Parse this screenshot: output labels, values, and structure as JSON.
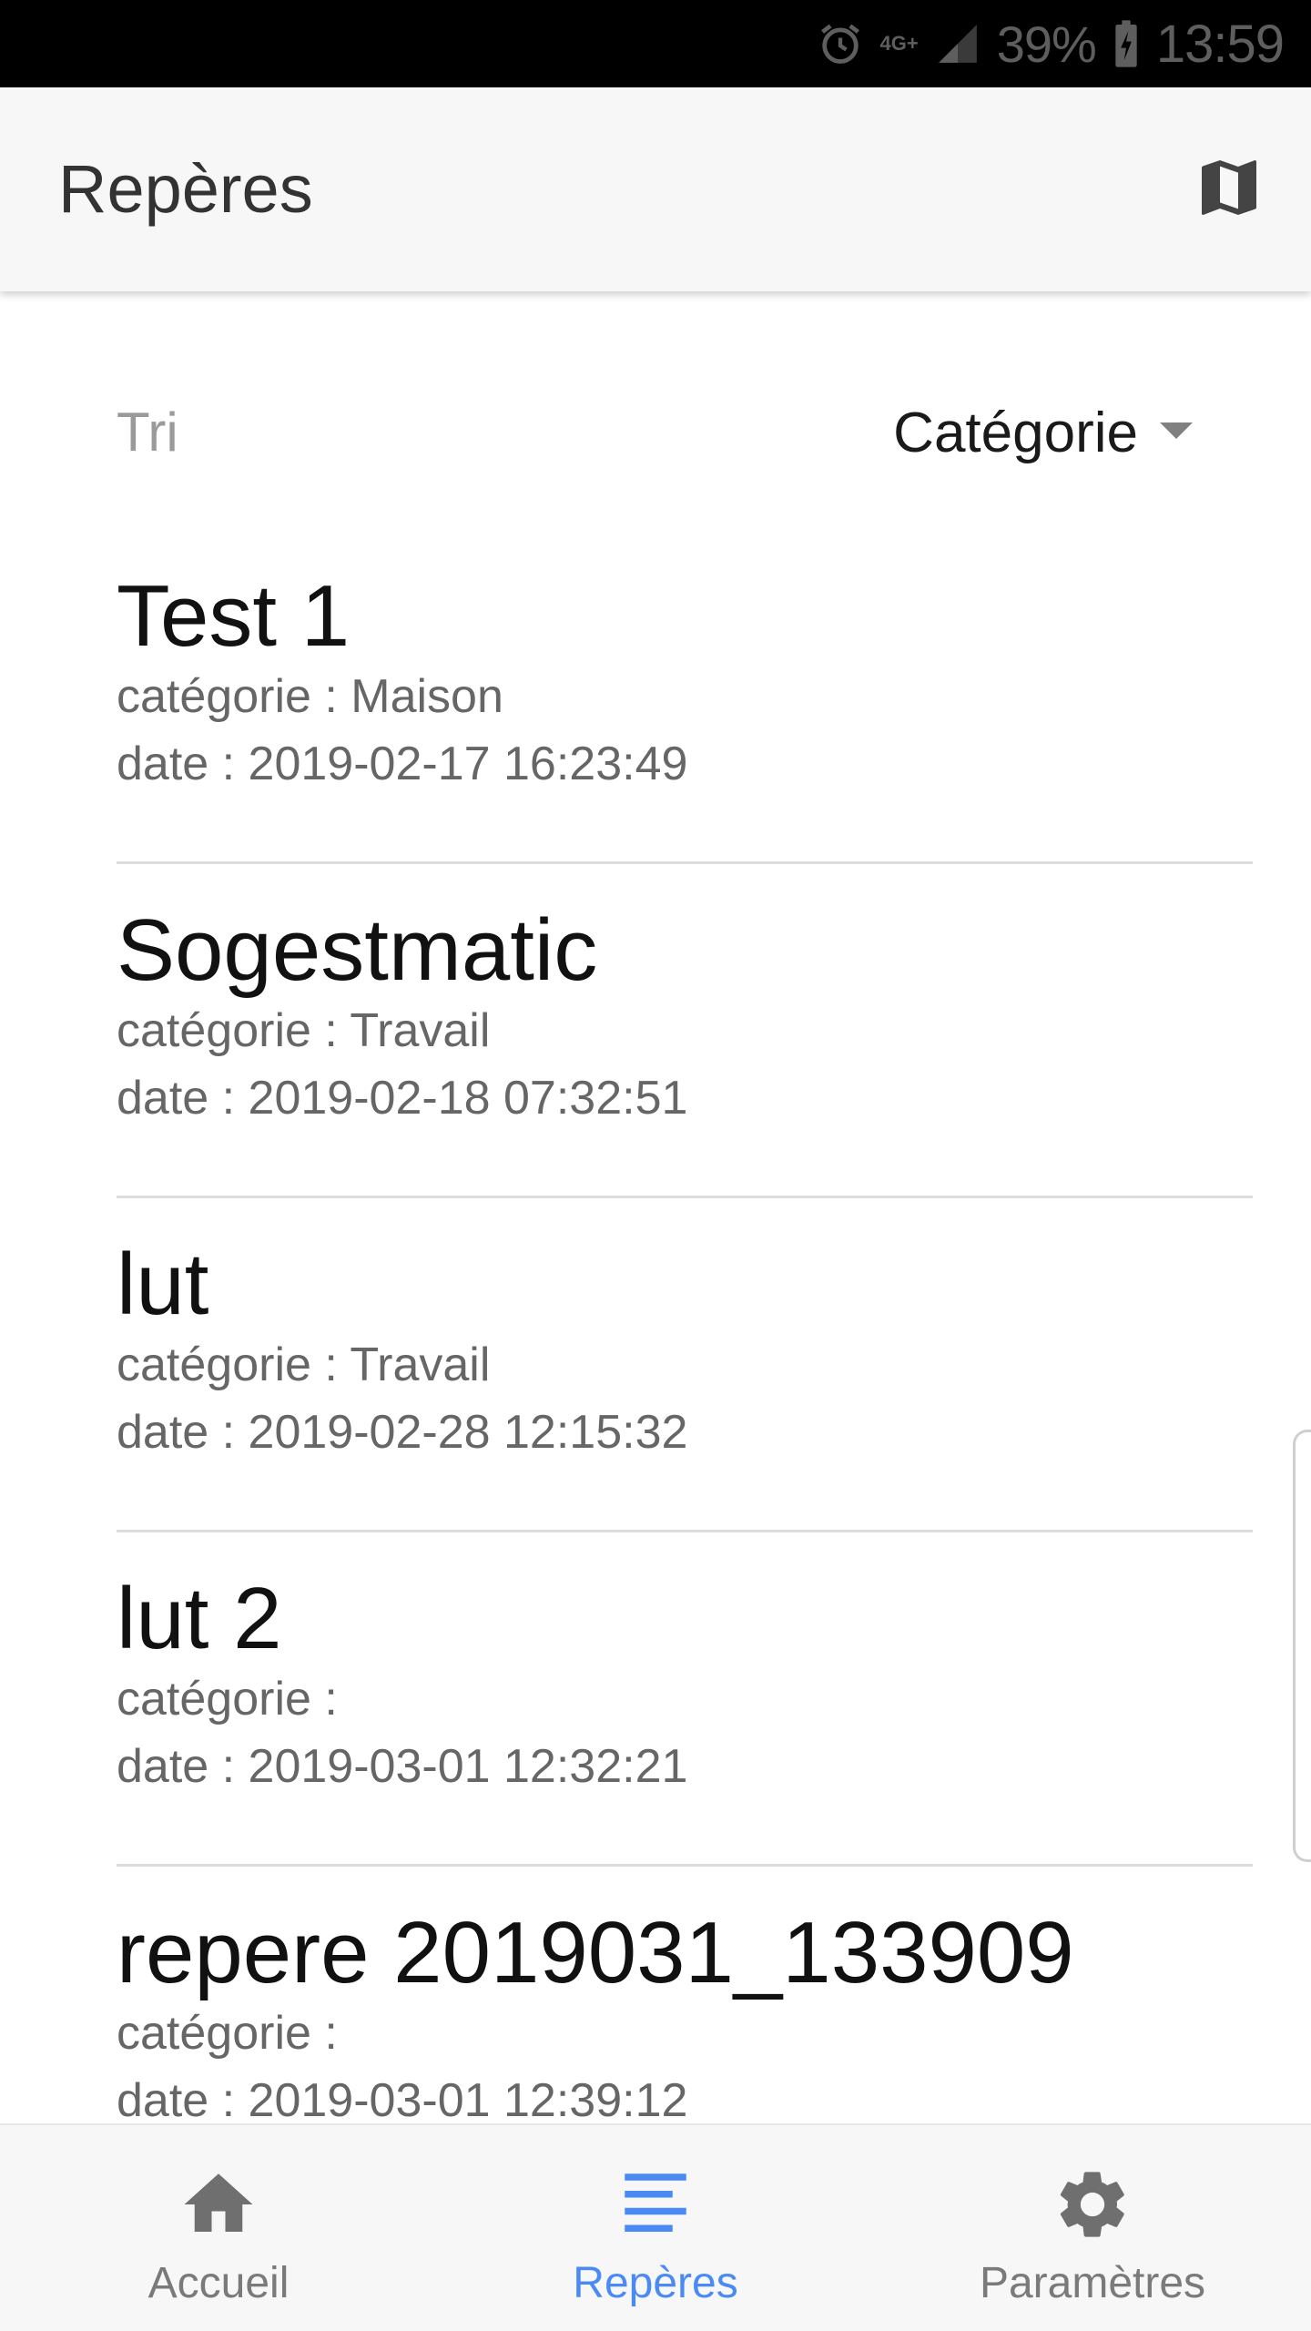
{
  "status_bar": {
    "network": "4G+",
    "battery": "39%",
    "time": "13:59"
  },
  "app_bar": {
    "title": "Repères",
    "map_icon": "map-icon"
  },
  "sort": {
    "label": "Tri",
    "selected": "Catégorie"
  },
  "items": [
    {
      "title": "Test 1",
      "category": "catégorie : Maison",
      "date": "date : 2019-02-17 16:23:49"
    },
    {
      "title": "Sogestmatic",
      "category": "catégorie : Travail",
      "date": "date : 2019-02-18 07:32:51"
    },
    {
      "title": "lut",
      "category": "catégorie : Travail",
      "date": "date : 2019-02-28 12:15:32"
    },
    {
      "title": "lut 2",
      "category": "catégorie :",
      "date": "date : 2019-03-01 12:32:21"
    },
    {
      "title": "repere 2019031_133909",
      "category": "catégorie :",
      "date": "date : 2019-03-01 12:39:12"
    }
  ],
  "bottom_nav": {
    "items": [
      {
        "label": "Accueil",
        "icon": "home-icon",
        "active": false
      },
      {
        "label": "Repères",
        "icon": "list-icon",
        "active": true
      },
      {
        "label": "Paramètres",
        "icon": "gear-icon",
        "active": false
      }
    ]
  },
  "colors": {
    "accent": "#4a8af4",
    "app_bar_bg": "#f7f7f7",
    "status_bar_bg": "#000000"
  }
}
